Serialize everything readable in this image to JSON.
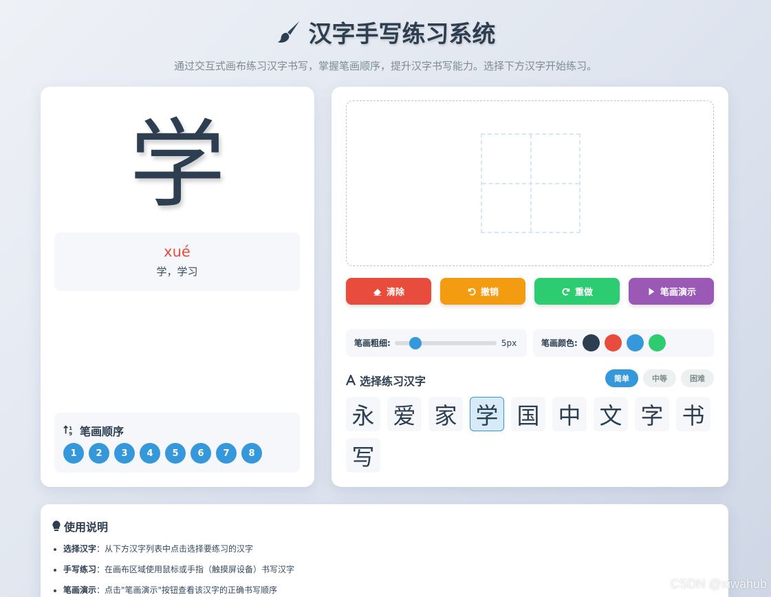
{
  "header": {
    "title": "汉字手写练习系统",
    "subtitle": "通过交互式画布练习汉字书写，掌握笔画顺序，提升汉字书写能力。选择下方汉字开始练习。"
  },
  "current": {
    "character": "学",
    "pinyin": "xué",
    "meaning": "学，学习"
  },
  "stroke_order": {
    "title": "笔画顺序",
    "numbers": [
      "1",
      "2",
      "3",
      "4",
      "5",
      "6",
      "7",
      "8"
    ]
  },
  "buttons": {
    "clear": "清除",
    "undo": "撤销",
    "redo": "重做",
    "demo": "笔画演示"
  },
  "settings": {
    "thickness_label": "笔画粗细:",
    "thickness_value": "5px",
    "thickness_fraction": 0.14,
    "color_label": "笔画颜色:",
    "colors": [
      "#2c3e50",
      "#e74c3c",
      "#3498db",
      "#2ecc71"
    ]
  },
  "selector": {
    "title": "选择练习汉字",
    "levels": [
      "简单",
      "中等",
      "困难"
    ],
    "active_level": "简单",
    "characters": [
      "永",
      "爱",
      "家",
      "学",
      "国",
      "中",
      "文",
      "字",
      "书",
      "写"
    ],
    "active_character": "学"
  },
  "guide": {
    "title": "使用说明",
    "items": [
      {
        "label": "选择汉字",
        "text": "：从下方汉字列表中点击选择要练习的汉字"
      },
      {
        "label": "手写练习",
        "text": "：在画布区域使用鼠标或手指（触摸屏设备）书写汉字"
      },
      {
        "label": "笔画演示",
        "text": "：点击\"笔画演示\"按钮查看该汉字的正确书写顺序"
      }
    ]
  },
  "watermark": "CSDN @xiwahub"
}
